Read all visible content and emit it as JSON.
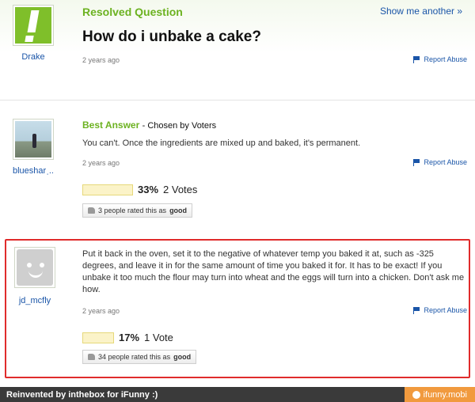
{
  "question": {
    "status": "Resolved Question",
    "show_another": "Show me another »",
    "title": "How do i unbake a cake?",
    "asker": "Drake",
    "time": "2 years ago",
    "report": "Report Abuse"
  },
  "best_answer": {
    "label": "Best Answer",
    "chosen": "- Chosen by Voters",
    "text": "You can't. Once the ingredients are mixed up and baked, it's permanent.",
    "author": "bluesharˌ..",
    "time": "2 years ago",
    "report": "Report Abuse",
    "vote_percent": "33%",
    "votes": "2 Votes",
    "vote_fraction": 0.33,
    "rated_prefix": "3 people rated this as",
    "rated_word": "good"
  },
  "answer2": {
    "text": "Put it back in the oven, set it to the negative of whatever temp you baked it at, such as -325 degrees, and leave it in for the same amount of time you baked it for. It has to be exact! If you unbake it too much the flour may turn into wheat and the eggs will turn into a chicken. Don't ask me how.",
    "author": "jd_mcfly",
    "time": "2 years ago",
    "report": "Report Abuse",
    "vote_percent": "17%",
    "votes": "1 Vote",
    "vote_fraction": 0.17,
    "rated_prefix": "34 people rated this as",
    "rated_word": "good"
  },
  "footer": {
    "left": "Reinvented by inthebox for iFunny :)",
    "right": "ifunny.mobi"
  },
  "icons": [
    "logo-exclamation-icon",
    "flag-icon",
    "thumbs-up-icon",
    "smiley-avatar-icon",
    "ifunny-face-icon"
  ]
}
